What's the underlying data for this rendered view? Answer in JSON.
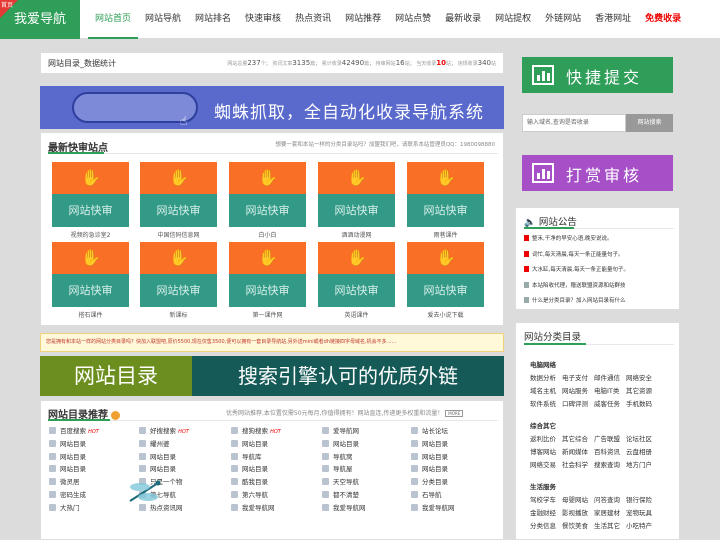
{
  "header": {
    "logo_text": "我爱导航",
    "logo_corner": "首页",
    "nav": [
      "网站首页",
      "网站导航",
      "网站排名",
      "快速审核",
      "热点资讯",
      "网站推荐",
      "网站点赞",
      "最新收录",
      "网站提权",
      "外链网站",
      "香港网址",
      "免费收录"
    ]
  },
  "stats": {
    "title": "网站目录_数据统计",
    "items": [
      {
        "label": "网站总量",
        "value": "237",
        "unit": "个；"
      },
      {
        "label": "资讯文章",
        "value": "3135",
        "unit": "篇；"
      },
      {
        "label": "累计收录",
        "value": "42490",
        "unit": "篇；"
      },
      {
        "label": "待审网站",
        "value": "16",
        "unit": "站；"
      },
      {
        "label": "当天收录",
        "value": "10",
        "unit": "站；"
      },
      {
        "label": "违规收录",
        "value": "340",
        "unit": "站"
      }
    ]
  },
  "banner1": {
    "text": "蜘蛛抓取，全自动化收录导航系统"
  },
  "fast": {
    "title": "最新快审站点",
    "note": "想要一套和本站一样的分类目录站吗？加盟我们吧，请联系本站管理员QQ：1980098880",
    "tile_label": "网站快审",
    "tiles": [
      "视频的急诊室2",
      "中国信码信息网",
      "白小白",
      "酒酒动漫网",
      "雨巷课件",
      "搭石课件",
      "新课标",
      "第一课件网",
      "英语课件",
      "爱去小说下载"
    ]
  },
  "ticker": "您是拥有和本站一样的网站分类目录吗？快加入联盟吧,原价5500,现在仅售3500,便可以拥有一套目录导航站,另外送mini或者dh链接四字母域名,机会不多……",
  "banner2": {
    "left": "网站目录",
    "right": "搜索引擎认可的优质外链"
  },
  "recommend": {
    "title": "网站目录推荐",
    "badge": "荐",
    "note": "优秀网站推荐,本位置仅需50元每月,你值得拥有！网站直连,传递更多权重和流量！",
    "more": "MORE",
    "columns": [
      [
        "百度搜索",
        "网站目录",
        "网站目录",
        "网站目录",
        "微灵居",
        "密码生成",
        "大热门"
      ],
      [
        "好搜搜索",
        "耀州婆",
        "网站目录",
        "网站目录",
        "只是一个物",
        "第七导航",
        "热点资讯网"
      ],
      [
        "搜狗搜索",
        "网站目录",
        "导航库",
        "网站目录",
        "酷我目录",
        "第六导航",
        "我爱导航网"
      ],
      [
        "爱导航网",
        "网站目录",
        "导航窝",
        "导航屋",
        "天空导航",
        "都不清楚",
        "我爱导航网"
      ],
      [
        "站长论坛",
        "网站目录",
        "网站目录",
        "网站目录",
        "分类目录",
        "石导航",
        "我爱导航网"
      ]
    ],
    "heart": "HOT"
  },
  "right": {
    "quick_button": "快捷提交",
    "search_placeholder": "输入域名,查询是否收录",
    "search_button": "网站搜索",
    "reward_button": "打赏审核",
    "notice": {
      "title": "网站公告",
      "items": [
        "整禾,千净的早安心语,晚安说说。",
        "词忙,每天清晨,每天一条正能量句子。",
        "大水缸,每天清晨,每天一条正能量句子。",
        "本站陷收代理，赠送联盟资源和站群技",
        "什么是分类目录？加入网站目录有什么"
      ]
    },
    "categories": {
      "title": "网站分类目录",
      "groups": [
        {
          "title": "电脑网络",
          "rows": [
            [
              "数据分析",
              "电子支付",
              "邮件通信",
              "网络安全"
            ],
            [
              "域名主机",
              "网站服务",
              "电脑IT类",
              "其它资源"
            ],
            [
              "软件系统",
              "口碑评测",
              "威客任务",
              "手机数码"
            ]
          ]
        },
        {
          "title": "综合其它",
          "rows": [
            [
              "返利比价",
              "其它综合",
              "广告联盟",
              "论坛社区"
            ],
            [
              "博客网站",
              "新闻媒体",
              "百科资讯",
              "云盘相册"
            ],
            [
              "网络交易",
              "社会科学",
              "搜索查询",
              "地方门户"
            ]
          ]
        },
        {
          "title": "生活服务",
          "rows": [
            [
              "驾校学车",
              "母婴网站",
              "问答查询",
              "银行保险"
            ],
            [
              "金融财经",
              "影视播放",
              "家居建材",
              "宠物玩具"
            ],
            [
              "分类信息",
              "餐饮美食",
              "生活其它",
              "小吃特产"
            ]
          ]
        }
      ]
    }
  },
  "colors": {
    "brand": "#2e9e58",
    "reward": "#a64fc7",
    "banner1": "#5969cc",
    "tile_top": "#f96f26",
    "tile_bottom": "#339a88"
  }
}
